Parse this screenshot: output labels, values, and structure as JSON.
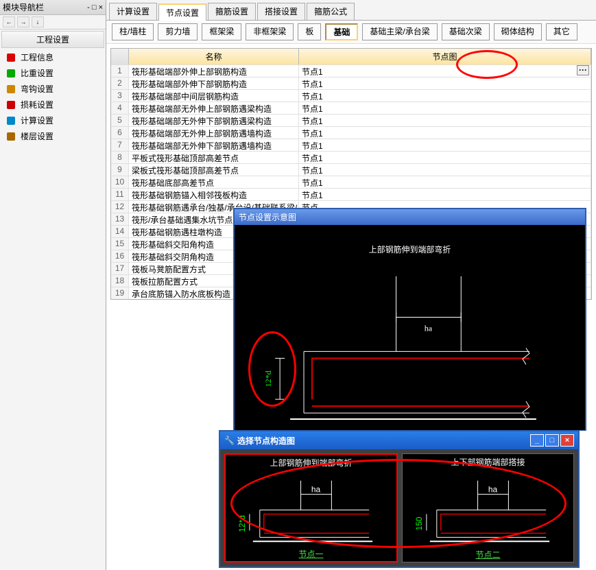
{
  "sidebar": {
    "title": "模块导航栏",
    "pin_controls": "- □ ×",
    "section": "工程设置",
    "items": [
      {
        "label": "工程信息",
        "icon_color": "#d00"
      },
      {
        "label": "比重设置",
        "icon_color": "#0a0"
      },
      {
        "label": "弯钩设置",
        "icon_color": "#c80"
      },
      {
        "label": "损耗设置",
        "icon_color": "#c00"
      },
      {
        "label": "计算设置",
        "icon_color": "#08c"
      },
      {
        "label": "楼层设置",
        "icon_color": "#a60"
      }
    ],
    "toolbar_btns": [
      "←",
      "→",
      "↓"
    ]
  },
  "tabs": {
    "row1": [
      {
        "label": "计算设置"
      },
      {
        "label": "节点设置",
        "active": true
      },
      {
        "label": "箍筋设置"
      },
      {
        "label": "搭接设置"
      },
      {
        "label": "箍筋公式"
      }
    ],
    "row2": [
      {
        "label": "柱/墙柱"
      },
      {
        "label": "剪力墙"
      },
      {
        "label": "框架梁"
      },
      {
        "label": "非框架梁"
      },
      {
        "label": "板"
      },
      {
        "label": "基础",
        "active": true
      },
      {
        "label": "基础主梁/承台梁"
      },
      {
        "label": "基础次梁"
      },
      {
        "label": "砌体结构"
      },
      {
        "label": "其它"
      }
    ]
  },
  "grid": {
    "header_name": "名称",
    "header_node": "节点图",
    "rows": [
      {
        "name": "筏形基础端部外伸上部钢筋构造",
        "node": "节点1",
        "selected": true,
        "ellipsis": true
      },
      {
        "name": "筏形基础端部外伸下部钢筋构造",
        "node": "节点1"
      },
      {
        "name": "筏形基础端部中间层钢筋构造",
        "node": "节点1"
      },
      {
        "name": "筏形基础端部无外伸上部钢筋遇梁构造",
        "node": "节点1"
      },
      {
        "name": "筏形基础端部无外伸下部钢筋遇梁构造",
        "node": "节点1"
      },
      {
        "name": "筏形基础端部无外伸上部钢筋遇墙构造",
        "node": "节点1"
      },
      {
        "name": "筏形基础端部无外伸下部钢筋遇墙构造",
        "node": "节点1"
      },
      {
        "name": "平板式筏形基础顶部高差节点",
        "node": "节点1"
      },
      {
        "name": "梁板式筏形基础顶部高差节点",
        "node": "节点1"
      },
      {
        "name": "筏形基础底部高差节点",
        "node": "节点1"
      },
      {
        "name": "筏形基础钢筋锚入相邻筏板构造",
        "node": "节点1"
      },
      {
        "name": "筏形基础钢筋遇承台/独基/承台设/基础联系梁/",
        "node": "节点"
      },
      {
        "name": "筏形/承台基础遇集水坑节点",
        "node": ""
      },
      {
        "name": "筏形基础钢筋遇柱墩构造",
        "node": ""
      },
      {
        "name": "筏形基础斜交阳角构造",
        "node": ""
      },
      {
        "name": "筏形基础斜交阴角构造",
        "node": ""
      },
      {
        "name": "筏板马凳筋配置方式",
        "node": ""
      },
      {
        "name": "筏板拉筋配置方式",
        "node": ""
      },
      {
        "name": "承台底筋锚入防水底板构造",
        "node": ""
      }
    ]
  },
  "preview_window": {
    "title": "节点设置示意图",
    "caption": "上部钢筋伸到端部弯折",
    "label_ha": "ha",
    "label_12d": "12*d"
  },
  "dialog": {
    "title": "选择节点构造图",
    "options": [
      {
        "caption": "上部钢筋伸到端部弯折",
        "link": "节点一",
        "selected": true,
        "label1": "ha",
        "label2": "12*d"
      },
      {
        "caption": "上下部钢筋端部搭接",
        "link": "节点二",
        "label1": "ha",
        "label2": "150"
      }
    ]
  }
}
